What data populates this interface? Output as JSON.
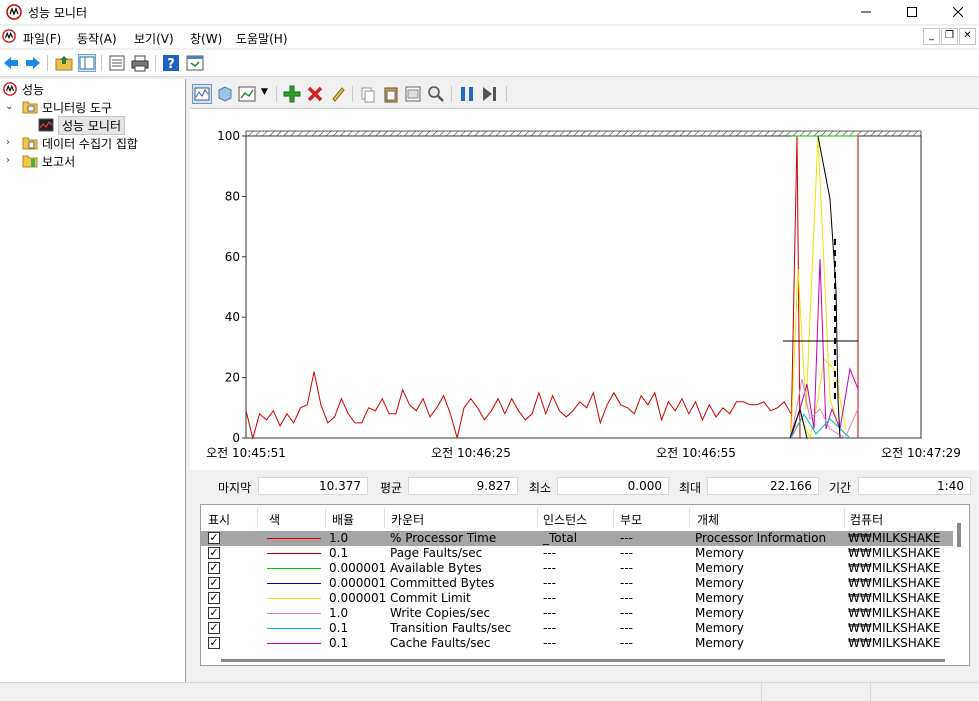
{
  "window": {
    "title": "성능 모니터"
  },
  "menu": {
    "items": [
      "파일(F)",
      "동작(A)",
      "보기(V)",
      "창(W)",
      "도움말(H)"
    ]
  },
  "tree": {
    "root": "성능",
    "monitoring_tools": "모니터링 도구",
    "perf_monitor": "성능 모니터",
    "data_collector_sets": "데이터 수집기 집합",
    "reports": "보고서"
  },
  "chart_data": {
    "type": "line",
    "ylim": [
      0,
      100
    ],
    "y_ticks": [
      "0",
      "20",
      "40",
      "60",
      "80",
      "100"
    ],
    "x_ticks": [
      "오전 10:45:51",
      "오전 10:46:25",
      "오전 10:46:55",
      "오전 10:47:29"
    ],
    "series": [
      {
        "name": "% Processor Time",
        "color": "#cc0000",
        "values": [
          9,
          0,
          8,
          6,
          9,
          4,
          8,
          5,
          10,
          11,
          22,
          11,
          5,
          7,
          13,
          8,
          5,
          5,
          10,
          9,
          13,
          8,
          8,
          16,
          11,
          9,
          13,
          7,
          10,
          14,
          8,
          0,
          10,
          13,
          10,
          6,
          9,
          13,
          8,
          13,
          9,
          6,
          8,
          15,
          8,
          14,
          9,
          7,
          9,
          12,
          10,
          15,
          5,
          11,
          15,
          11,
          10,
          8,
          14,
          11,
          15,
          6,
          12,
          9,
          13,
          8,
          12,
          6,
          11,
          7,
          10,
          8,
          12,
          12,
          11,
          11,
          12,
          9,
          10,
          12,
          8
        ]
      }
    ]
  },
  "stats": {
    "last_label": "마지막",
    "last_value": "10.377",
    "avg_label": "평균",
    "avg_value": "9.827",
    "min_label": "최소",
    "min_value": "0.000",
    "max_label": "최대",
    "max_value": "22.166",
    "duration_label": "기간",
    "duration_value": "1:40"
  },
  "legend": {
    "headers": [
      "표시",
      "색",
      "배율",
      "카운터",
      "인스턴스",
      "부모",
      "개체",
      "컴퓨터"
    ],
    "rows": [
      {
        "color": "#e00000",
        "scale": "1.0",
        "counter": "% Processor Time",
        "instance": "_Total",
        "parent": "---",
        "object": "Processor Information",
        "computer": "₩₩MILKSHAKE"
      },
      {
        "color": "#b00000",
        "scale": "0.1",
        "counter": "Page Faults/sec",
        "instance": "---",
        "parent": "---",
        "object": "Memory",
        "computer": "₩₩MILKSHAKE"
      },
      {
        "color": "#00c000",
        "scale": "0.000001",
        "counter": "Available Bytes",
        "instance": "---",
        "parent": "---",
        "object": "Memory",
        "computer": "₩₩MILKSHAKE"
      },
      {
        "color": "#0000a0",
        "scale": "0.000001",
        "counter": "Committed Bytes",
        "instance": "---",
        "parent": "---",
        "object": "Memory",
        "computer": "₩₩MILKSHAKE"
      },
      {
        "color": "#e8e800",
        "scale": "0.000001",
        "counter": "Commit Limit",
        "instance": "---",
        "parent": "---",
        "object": "Memory",
        "computer": "₩₩MILKSHAKE"
      },
      {
        "color": "#e080c0",
        "scale": "1.0",
        "counter": "Write Copies/sec",
        "instance": "---",
        "parent": "---",
        "object": "Memory",
        "computer": "₩₩MILKSHAKE"
      },
      {
        "color": "#00c0c0",
        "scale": "0.1",
        "counter": "Transition Faults/sec",
        "instance": "---",
        "parent": "---",
        "object": "Memory",
        "computer": "₩₩MILKSHAKE"
      },
      {
        "color": "#c000c0",
        "scale": "0.1",
        "counter": "Cache Faults/sec",
        "instance": "---",
        "parent": "---",
        "object": "Memory",
        "computer": "₩₩MILKSHAKE"
      }
    ]
  }
}
